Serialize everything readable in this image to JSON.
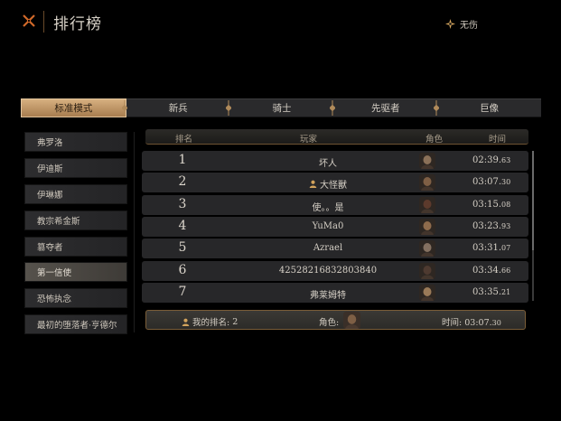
{
  "header": {
    "title": "排行榜",
    "status_label": "无伤",
    "status_icon": "compass-star-icon"
  },
  "tabs": [
    {
      "label": "标准模式",
      "active": true
    },
    {
      "label": "新兵",
      "active": false
    },
    {
      "label": "骑士",
      "active": false
    },
    {
      "label": "先驱者",
      "active": false
    },
    {
      "label": "巨像",
      "active": false
    }
  ],
  "sidebar": {
    "items": [
      {
        "label": "弗罗洛",
        "active": false
      },
      {
        "label": "伊迪斯",
        "active": false
      },
      {
        "label": "伊琳娜",
        "active": false
      },
      {
        "label": "教宗希金斯",
        "active": false
      },
      {
        "label": "篡夺者",
        "active": false
      },
      {
        "label": "第一信使",
        "active": true
      },
      {
        "label": "恐怖执念",
        "active": false
      },
      {
        "label": "最初的堕落者·亨德尔",
        "active": false
      }
    ]
  },
  "table": {
    "columns": {
      "rank": "排名",
      "player": "玩家",
      "role": "角色",
      "time": "时间"
    },
    "rows": [
      {
        "rank": "1",
        "player": "坏人",
        "is_self": false,
        "time_main": "02:39.",
        "time_ms": "63",
        "avatar_tone": "#8a7058"
      },
      {
        "rank": "2",
        "player": "大怪獸",
        "is_self": true,
        "time_main": "03:07.",
        "time_ms": "30",
        "avatar_tone": "#7e5f45"
      },
      {
        "rank": "3",
        "player": "使。。是",
        "is_self": false,
        "time_main": "03:15.",
        "time_ms": "08",
        "avatar_tone": "#5c3a2c"
      },
      {
        "rank": "4",
        "player": "YuMa0",
        "is_self": false,
        "time_main": "03:23.",
        "time_ms": "93",
        "avatar_tone": "#8e6b4c"
      },
      {
        "rank": "5",
        "player": "Azrael",
        "is_self": false,
        "time_main": "03:31.",
        "time_ms": "07",
        "avatar_tone": "#847060"
      },
      {
        "rank": "6",
        "player": "42528216832803840",
        "is_self": false,
        "time_main": "03:34.",
        "time_ms": "66",
        "avatar_tone": "#4e3a30"
      },
      {
        "rank": "7",
        "player": "弗莱姆特",
        "is_self": false,
        "time_main": "03:35.",
        "time_ms": "21",
        "avatar_tone": "#9a7a58"
      }
    ]
  },
  "footer": {
    "my_rank_label": "我的排名:",
    "my_rank_value": "2",
    "role_label": "角色:",
    "time_label": "时间:",
    "time_main": "03:07.",
    "time_ms": "30"
  },
  "colors": {
    "accent_gold": "#d7b080",
    "row_bg": "#272729",
    "border_bronze": "#7a5d38"
  }
}
